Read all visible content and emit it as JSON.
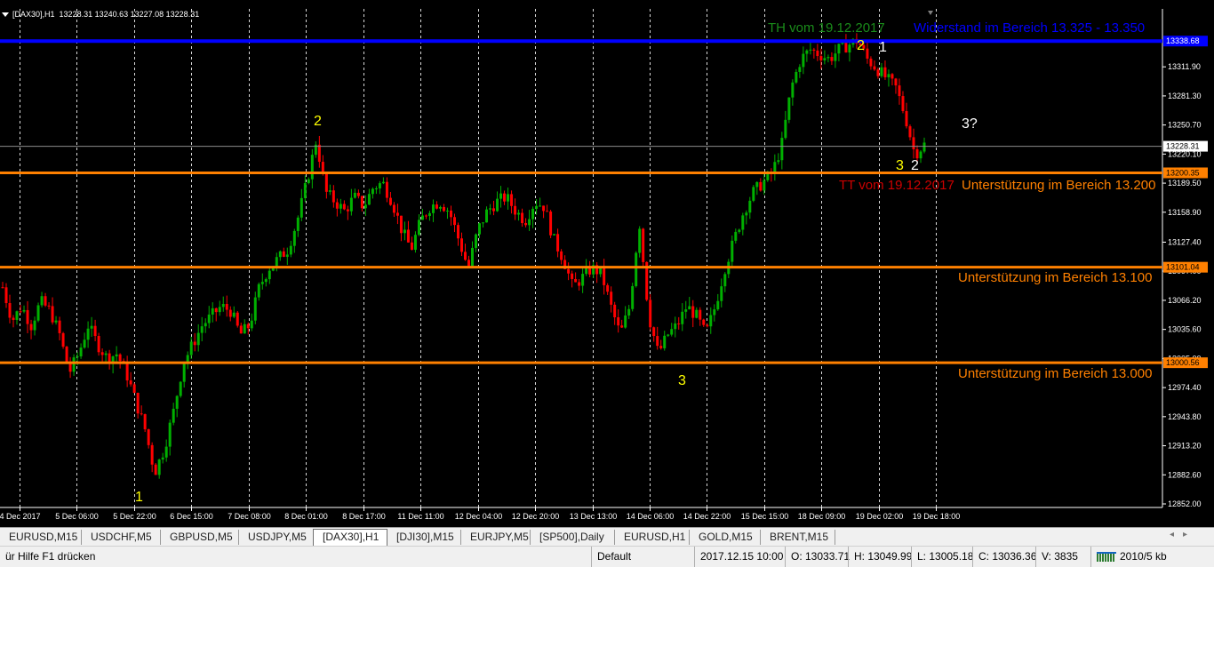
{
  "header": {
    "symbol_label": "[DAX30],H1",
    "ohlc": "13228.31 13240.63 13227.08 13228.31"
  },
  "chart_data": {
    "type": "candlestick",
    "y_range": [
      12852.0,
      13342.0
    ],
    "price_ticks": [
      "13311.90",
      "13281.30",
      "13250.70",
      "13220.10",
      "13189.50",
      "13158.90",
      "13127.40",
      "13097.00",
      "13066.20",
      "13035.60",
      "13005.00",
      "12974.40",
      "12943.80",
      "12913.20",
      "12882.60",
      "12852.00"
    ],
    "time_ticks": [
      "4 Dec 2017",
      "5 Dec 06:00",
      "5 Dec 22:00",
      "6 Dec 15:00",
      "7 Dec 08:00",
      "8 Dec 01:00",
      "8 Dec 17:00",
      "11 Dec 11:00",
      "12 Dec 04:00",
      "12 Dec 20:00",
      "13 Dec 13:00",
      "14 Dec 06:00",
      "14 Dec 22:00",
      "15 Dec 15:00",
      "18 Dec 09:00",
      "19 Dec 02:00",
      "19 Dec 18:00"
    ],
    "price_path": [
      13080,
      13045,
      13060,
      13040,
      13065,
      13055,
      13030,
      12990,
      13010,
      13040,
      13020,
      13005,
      13010,
      12990,
      12960,
      12930,
      12885,
      12910,
      12950,
      13000,
      13020,
      13040,
      13050,
      13060,
      13055,
      13030,
      13040,
      13080,
      13100,
      13110,
      13120,
      13150,
      13190,
      13235,
      13180,
      13170,
      13160,
      13175,
      13165,
      13185,
      13190,
      13170,
      13140,
      13120,
      13150,
      13165,
      13170,
      13160,
      13130,
      13100,
      13140,
      13160,
      13170,
      13175,
      13160,
      13150,
      13170,
      13165,
      13130,
      13110,
      13080,
      13090,
      13100,
      13095,
      13060,
      13030,
      13060,
      13150,
      13050,
      13010,
      13030,
      13040,
      13060,
      13050,
      13030,
      13060,
      13100,
      13130,
      13160,
      13180,
      13190,
      13200,
      13230,
      13290,
      13320,
      13330,
      13325,
      13320,
      13330,
      13335,
      13340,
      13320,
      13310,
      13300,
      13290,
      13260,
      13220,
      13230
    ],
    "levels": [
      {
        "value": 13339.0,
        "color": "#0000ff",
        "tag": "13338.68"
      },
      {
        "value": 13200.35,
        "color": "#ff8000",
        "tag": "13200.35"
      },
      {
        "value": 13101.04,
        "color": "#ff8000",
        "tag": "13101.04"
      },
      {
        "value": 13000.56,
        "color": "#ff8000",
        "tag": "13000.56"
      }
    ],
    "current_price": {
      "value": 13228.31,
      "tag": "13228.31"
    },
    "annotations": [
      {
        "text": "TH vom 19.12.2017",
        "color": "#1a8c1a"
      },
      {
        "text": "Widerstand im Bereich 13.325 - 13.350",
        "color": "#0000ff"
      },
      {
        "text": "2",
        "color": "#ffff00"
      },
      {
        "text": "1",
        "color": "#ffffff"
      },
      {
        "text": "2",
        "color": "#ffff00"
      },
      {
        "text": "3?",
        "color": "#ffffff"
      },
      {
        "text": "3",
        "color": "#ffff00"
      },
      {
        "text": "2",
        "color": "#ffffff"
      },
      {
        "text": "TT vom 19.12.2017",
        "color": "#cc0000"
      },
      {
        "text": "Unterstützung im Bereich 13.200",
        "color": "#ff8000"
      },
      {
        "text": "Unterstützung im Bereich 13.100",
        "color": "#ff8000"
      },
      {
        "text": "Unterstützung im Bereich 13.000",
        "color": "#ff8000"
      },
      {
        "text": "3",
        "color": "#ffff00"
      },
      {
        "text": "1",
        "color": "#ffff00"
      }
    ],
    "colors": {
      "bull": "#00b000",
      "bear": "#ff0000",
      "grid": "#ffffff",
      "background": "#000000"
    }
  },
  "tabs": [
    "EURUSD,M15",
    "USDCHF,M5",
    "GBPUSD,M5",
    "USDJPY,M5",
    "[DAX30],H1",
    "[DJI30],M15",
    "EURJPY,M5",
    "[SP500],Daily",
    "EURUSD,H1",
    "GOLD,M15",
    "BRENT,M15"
  ],
  "active_tab": "[DAX30],H1",
  "status": {
    "help": "ür Hilfe F1 drücken",
    "profile": "Default",
    "datetime": "2017.12.15 10:00",
    "open": "O: 13033.71",
    "high": "H: 13049.99",
    "low": "L: 13005.18",
    "close": "C: 13036.36",
    "volume": "V: 3835",
    "traffic": "2010/5 kb"
  }
}
